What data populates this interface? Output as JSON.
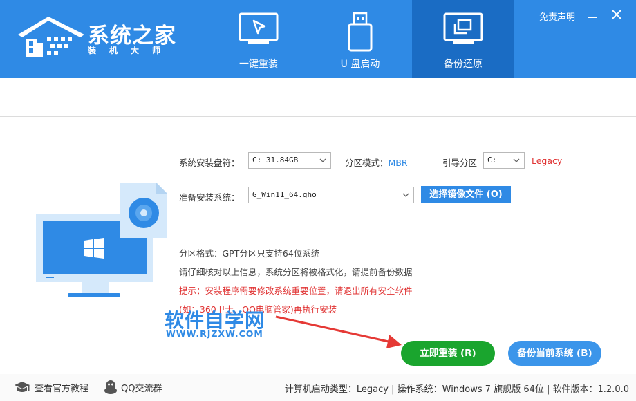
{
  "header": {
    "brand_title": "系统之家",
    "brand_subtitle": "装机大师",
    "disclaimer": "免责声明",
    "tabs": [
      {
        "label": "一键重装",
        "icon": "cursor-monitor-icon",
        "active": false
      },
      {
        "label": "U 盘启动",
        "icon": "usb-drive-icon",
        "active": false
      },
      {
        "label": "备份还原",
        "icon": "copy-restore-icon",
        "active": true
      }
    ]
  },
  "form": {
    "install_drive_label": "系统安装盘符：",
    "install_drive_value": "C: 31.84GB",
    "partition_mode_label": "分区模式：",
    "partition_mode_value": "MBR",
    "boot_partition_label": "引导分区",
    "boot_partition_value": "C:",
    "boot_type": "Legacy",
    "prepare_system_label": "准备安装系统：",
    "prepare_system_value": "G_Win11_64.gho",
    "pick_image_button": "选择镜像文件 (O)"
  },
  "info": {
    "partition_format": "分区格式：GPT分区只支持64位系统",
    "check_info": "请仔细核对以上信息，系统分区将被格式化，请提前备份数据",
    "tip_line1": "提示：安装程序需要修改系统重要位置，请退出所有安全软件",
    "tip_line2": "(如：360卫士、QQ电脑管家)再执行安装"
  },
  "watermark": {
    "main": "软件自学网",
    "sub": "WWW.RJZXW.COM"
  },
  "actions": {
    "reinstall": "立即重装 (R)",
    "backup": "备份当前系统 (B)"
  },
  "footer": {
    "tutorial": "查看官方教程",
    "qq_group": "QQ交流群",
    "status": "计算机启动类型：Legacy | 操作系统：Windows 7 旗舰版 64位 | 软件版本：1.2.0.0"
  },
  "colors": {
    "brand_blue": "#2f8ae5",
    "active_tab": "#1a6cc4",
    "warning_red": "#e03333",
    "primary_green": "#1aa52e"
  }
}
